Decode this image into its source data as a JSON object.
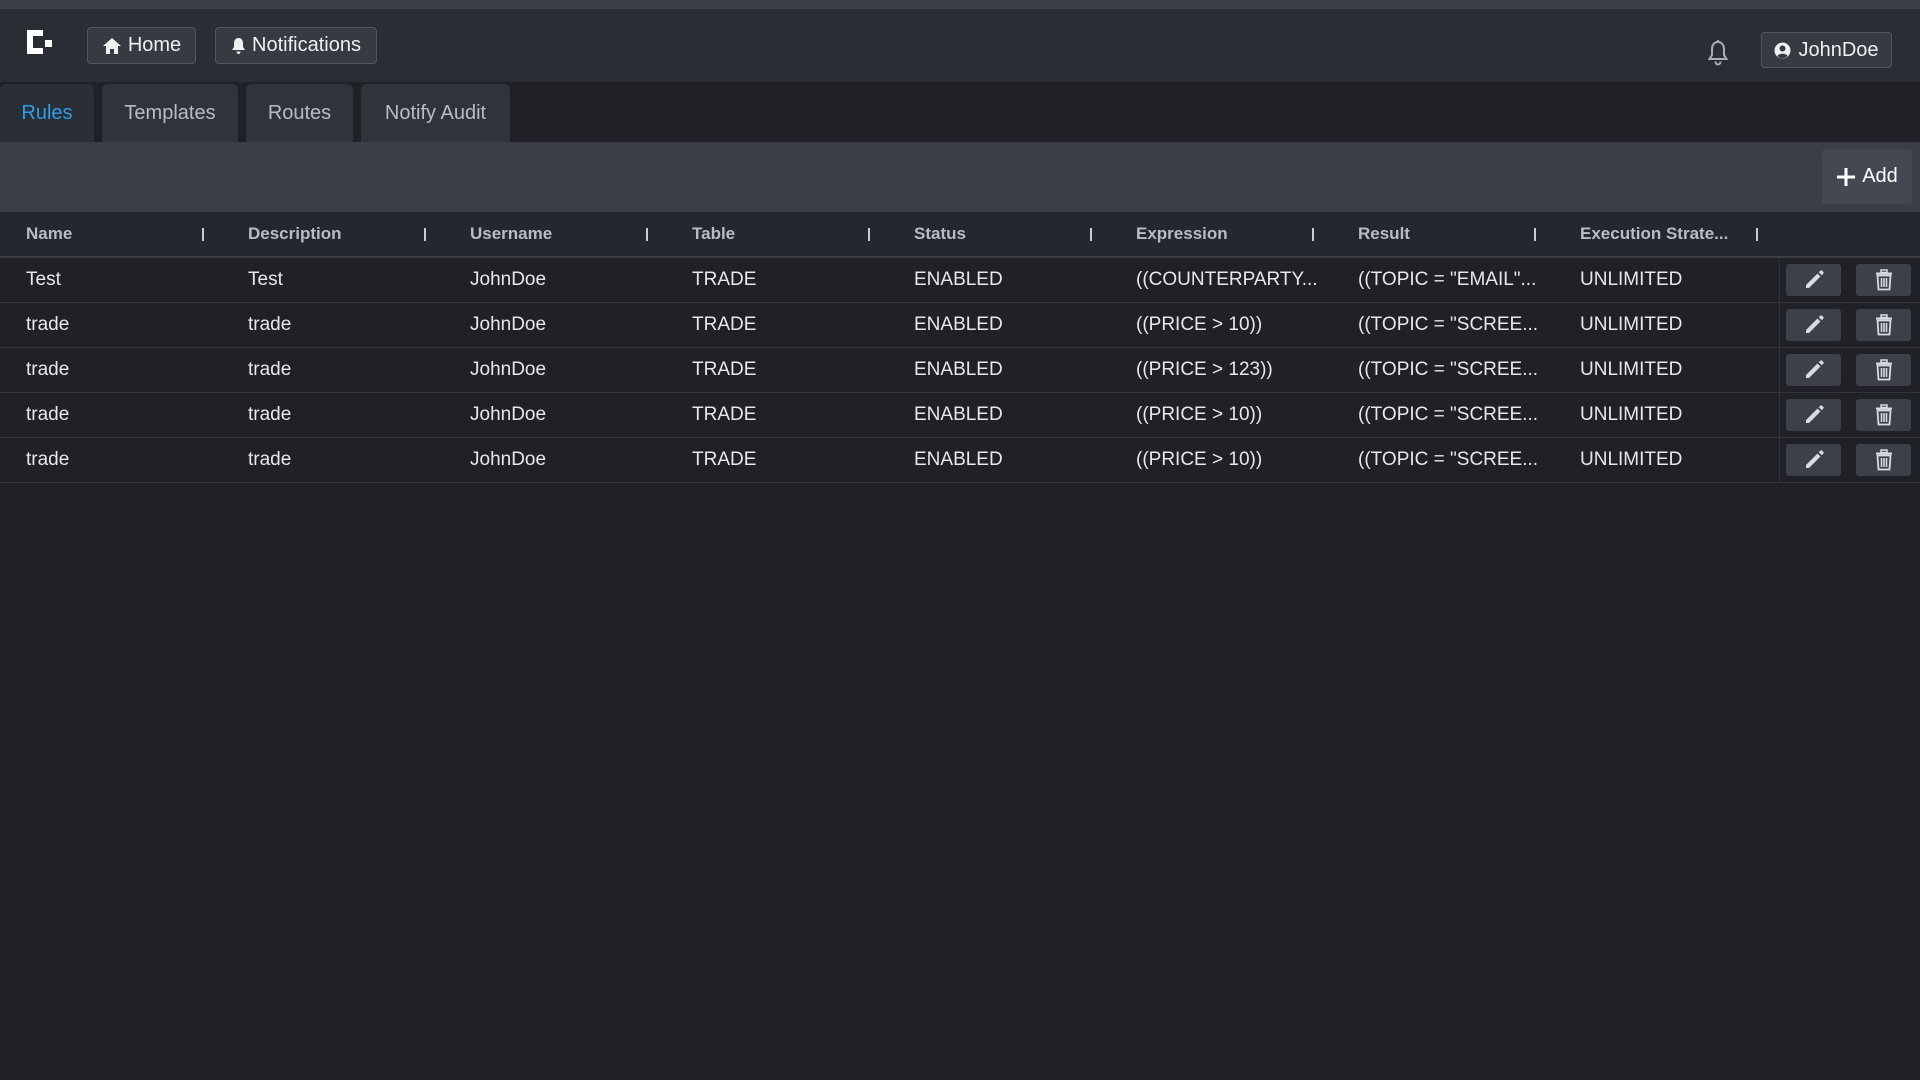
{
  "header": {
    "home_label": "Home",
    "notifications_label": "Notifications",
    "user_label": "JohnDoe"
  },
  "tabs": [
    {
      "label": "Rules",
      "active": true
    },
    {
      "label": "Templates",
      "active": false
    },
    {
      "label": "Routes",
      "active": false
    },
    {
      "label": "Notify Audit",
      "active": false
    }
  ],
  "toolbar": {
    "add_label": "Add"
  },
  "grid": {
    "columns": [
      "Name",
      "Description",
      "Username",
      "Table",
      "Status",
      "Expression",
      "Result",
      "Execution Strate..."
    ],
    "rows": [
      [
        "Test",
        "Test",
        "JohnDoe",
        "TRADE",
        "ENABLED",
        "((COUNTERPARTY...",
        "((TOPIC = \"EMAIL\"...",
        "UNLIMITED"
      ],
      [
        "trade",
        "trade",
        "JohnDoe",
        "TRADE",
        "ENABLED",
        "((PRICE > 10))",
        "((TOPIC = \"SCREE...",
        "UNLIMITED"
      ],
      [
        "trade",
        "trade",
        "JohnDoe",
        "TRADE",
        "ENABLED",
        "((PRICE > 123))",
        "((TOPIC = \"SCREE...",
        "UNLIMITED"
      ],
      [
        "trade",
        "trade",
        "JohnDoe",
        "TRADE",
        "ENABLED",
        "((PRICE > 10))",
        "((TOPIC = \"SCREE...",
        "UNLIMITED"
      ],
      [
        "trade",
        "trade",
        "JohnDoe",
        "TRADE",
        "ENABLED",
        "((PRICE > 10))",
        "((TOPIC = \"SCREE...",
        "UNLIMITED"
      ]
    ]
  },
  "colors": {
    "background": "#1f2126",
    "active_tab": "#2f9ee6",
    "toolbar": "#3a3f47"
  },
  "icons": [
    "logo-icon",
    "home-icon",
    "bell-icon",
    "user-circle-icon",
    "plus-icon",
    "pencil-icon",
    "trash-icon"
  ]
}
